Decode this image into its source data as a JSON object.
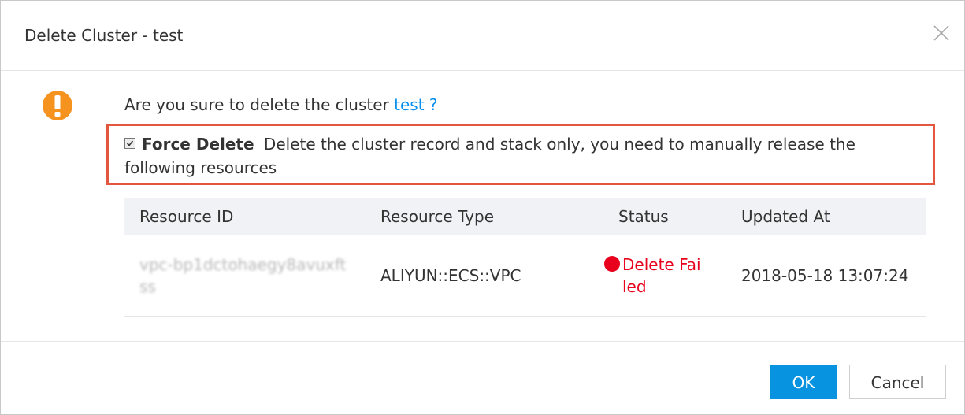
{
  "dialog": {
    "title": "Delete Cluster - test",
    "close_icon": "close-icon"
  },
  "message": {
    "icon": "warning-icon",
    "question_prefix": "Are you sure to delete the cluster ",
    "cluster_link": "test ?"
  },
  "force_delete": {
    "checked": true,
    "label": "Force Delete",
    "description": "Delete the cluster record and stack only, you need to manually release the following resources"
  },
  "resources": {
    "columns": [
      "Resource ID",
      "Resource Type",
      "Status",
      "Updated At"
    ],
    "rows": [
      {
        "resource_id": "vpc-bp1dctohaegy8avuxftss",
        "resource_type": "ALIYUN::ECS::VPC",
        "status": "Delete Failed",
        "updated_at": "2018-05-18 13:07:24"
      }
    ]
  },
  "colors": {
    "accent": "#0893e0",
    "link": "#0a90ec",
    "warning": "#f5931e",
    "error": "#e8001c",
    "highlight_border": "#e3573f"
  },
  "buttons": {
    "ok": "OK",
    "cancel": "Cancel"
  }
}
